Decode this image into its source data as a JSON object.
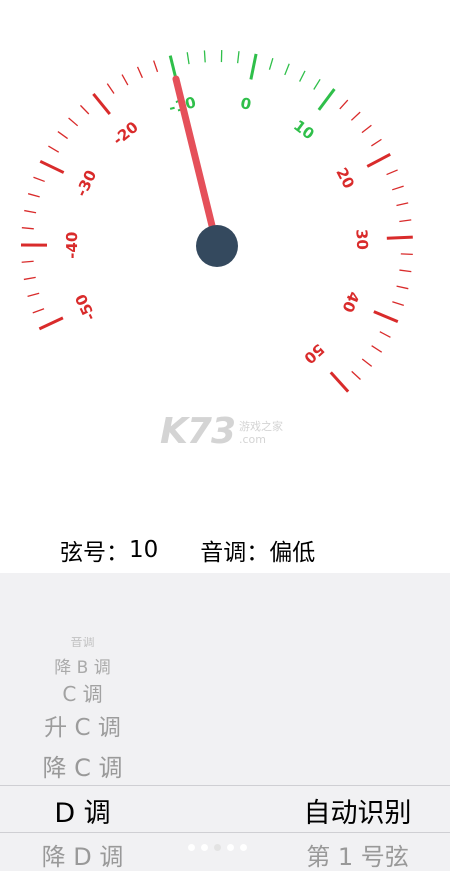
{
  "gauge": {
    "labels": [
      "-50",
      "-40",
      "-30",
      "-20",
      "-10",
      "0",
      "10",
      "20",
      "30",
      "40",
      "50"
    ],
    "min": -50,
    "max": 50,
    "needle_value": -10,
    "colors": {
      "in_tune": "#2fbf4a",
      "off": "#d92b2b",
      "needle": "#e5505a",
      "hub": "#34495e"
    }
  },
  "watermark": {
    "logo": "K73",
    "text_top": "游戏之家",
    "text_bottom": ".com"
  },
  "info": {
    "string_label": "弦号：",
    "string_value": "10",
    "tone_label": "音调：",
    "tone_value": "偏低"
  },
  "picker": {
    "key_items": [
      "音调",
      "降 B 调",
      "C 调",
      "升 C 调",
      "降 C 调",
      "D 调",
      "降 D 调"
    ],
    "mode_items": [
      "自动识别",
      "第 1 号弦"
    ],
    "selected_key": "D 调",
    "selected_mode": "自动识别"
  }
}
